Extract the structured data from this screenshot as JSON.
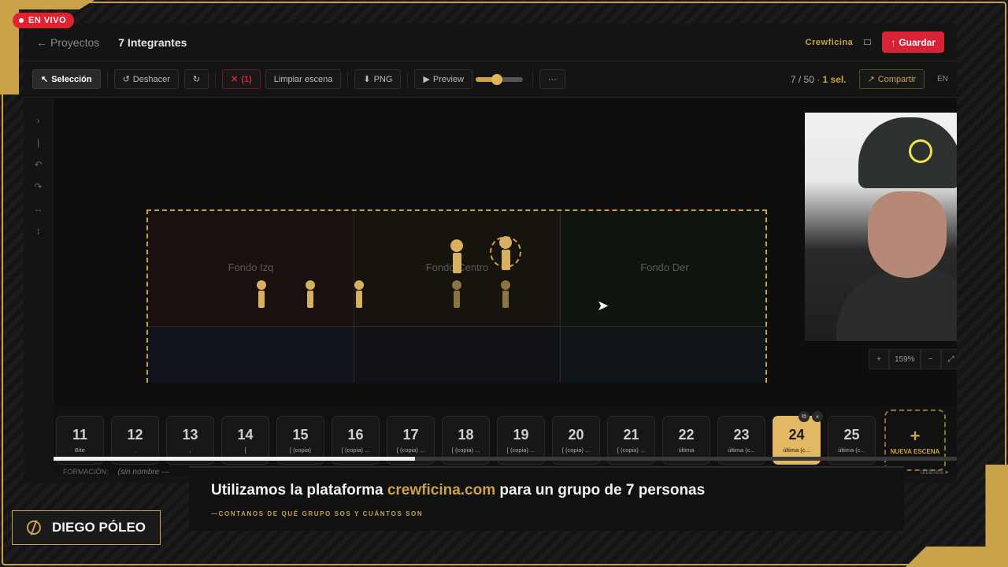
{
  "overlay": {
    "live_label": "EN VIVO",
    "presenter_name": "DIEGO PÓLEO",
    "lower_third": {
      "title_before": "Utilizamos la plataforma ",
      "title_highlight": "crewficina.com",
      "title_after": " para un grupo de 7 personas",
      "subtitle": "—CONTANOS DE QUÉ GRUPO SOS Y CUÁNTOS SON"
    },
    "accent_color": "#c9a24a",
    "live_color": "#e0232f"
  },
  "header": {
    "back_label": "Proyectos",
    "project_name": "7 Integrantes",
    "brand": "Crewficina",
    "save_label": "Guardar"
  },
  "toolbar": {
    "select_label": "Selección",
    "undo_label": "Deshacer",
    "redo_label": "↻",
    "delete_label": "(1)",
    "clear_label": "Limpiar escena",
    "png_label": "PNG",
    "preview_label": "Preview",
    "zoom_slider_fraction": 0.45,
    "more_label": "···",
    "counter_prefix": "7 / 50 · ",
    "counter_selected": "1 sel.",
    "share_label": "Compartir",
    "lang": "EN"
  },
  "stage": {
    "zones": [
      "Fondo Izq",
      "Fondo Centro",
      "Fondo Der"
    ],
    "zoom": "159%"
  },
  "scenes": [
    {
      "num": "11",
      "name": "Bite"
    },
    {
      "num": "12",
      "name": "."
    },
    {
      "num": "13",
      "name": ","
    },
    {
      "num": "14",
      "name": "["
    },
    {
      "num": "15",
      "name": "[ (copia)"
    },
    {
      "num": "16",
      "name": "[ (copia) ..."
    },
    {
      "num": "17",
      "name": "[ (copia) ..."
    },
    {
      "num": "18",
      "name": "[ (copia) ..."
    },
    {
      "num": "19",
      "name": "[ (copia) ..."
    },
    {
      "num": "20",
      "name": "[ (copia) ..."
    },
    {
      "num": "21",
      "name": "[ (copia) ..."
    },
    {
      "num": "22",
      "name": "última"
    },
    {
      "num": "23",
      "name": "última (c..."
    },
    {
      "num": "24",
      "name": "última (c..."
    },
    {
      "num": "25",
      "name": "última (c..."
    }
  ],
  "current_scene": "24",
  "new_scene_label": "NUEVA ESCENA",
  "formation": {
    "label": "FORMACIÓN:",
    "value": "(sin nombre —",
    "right": "ultánea ▸"
  }
}
